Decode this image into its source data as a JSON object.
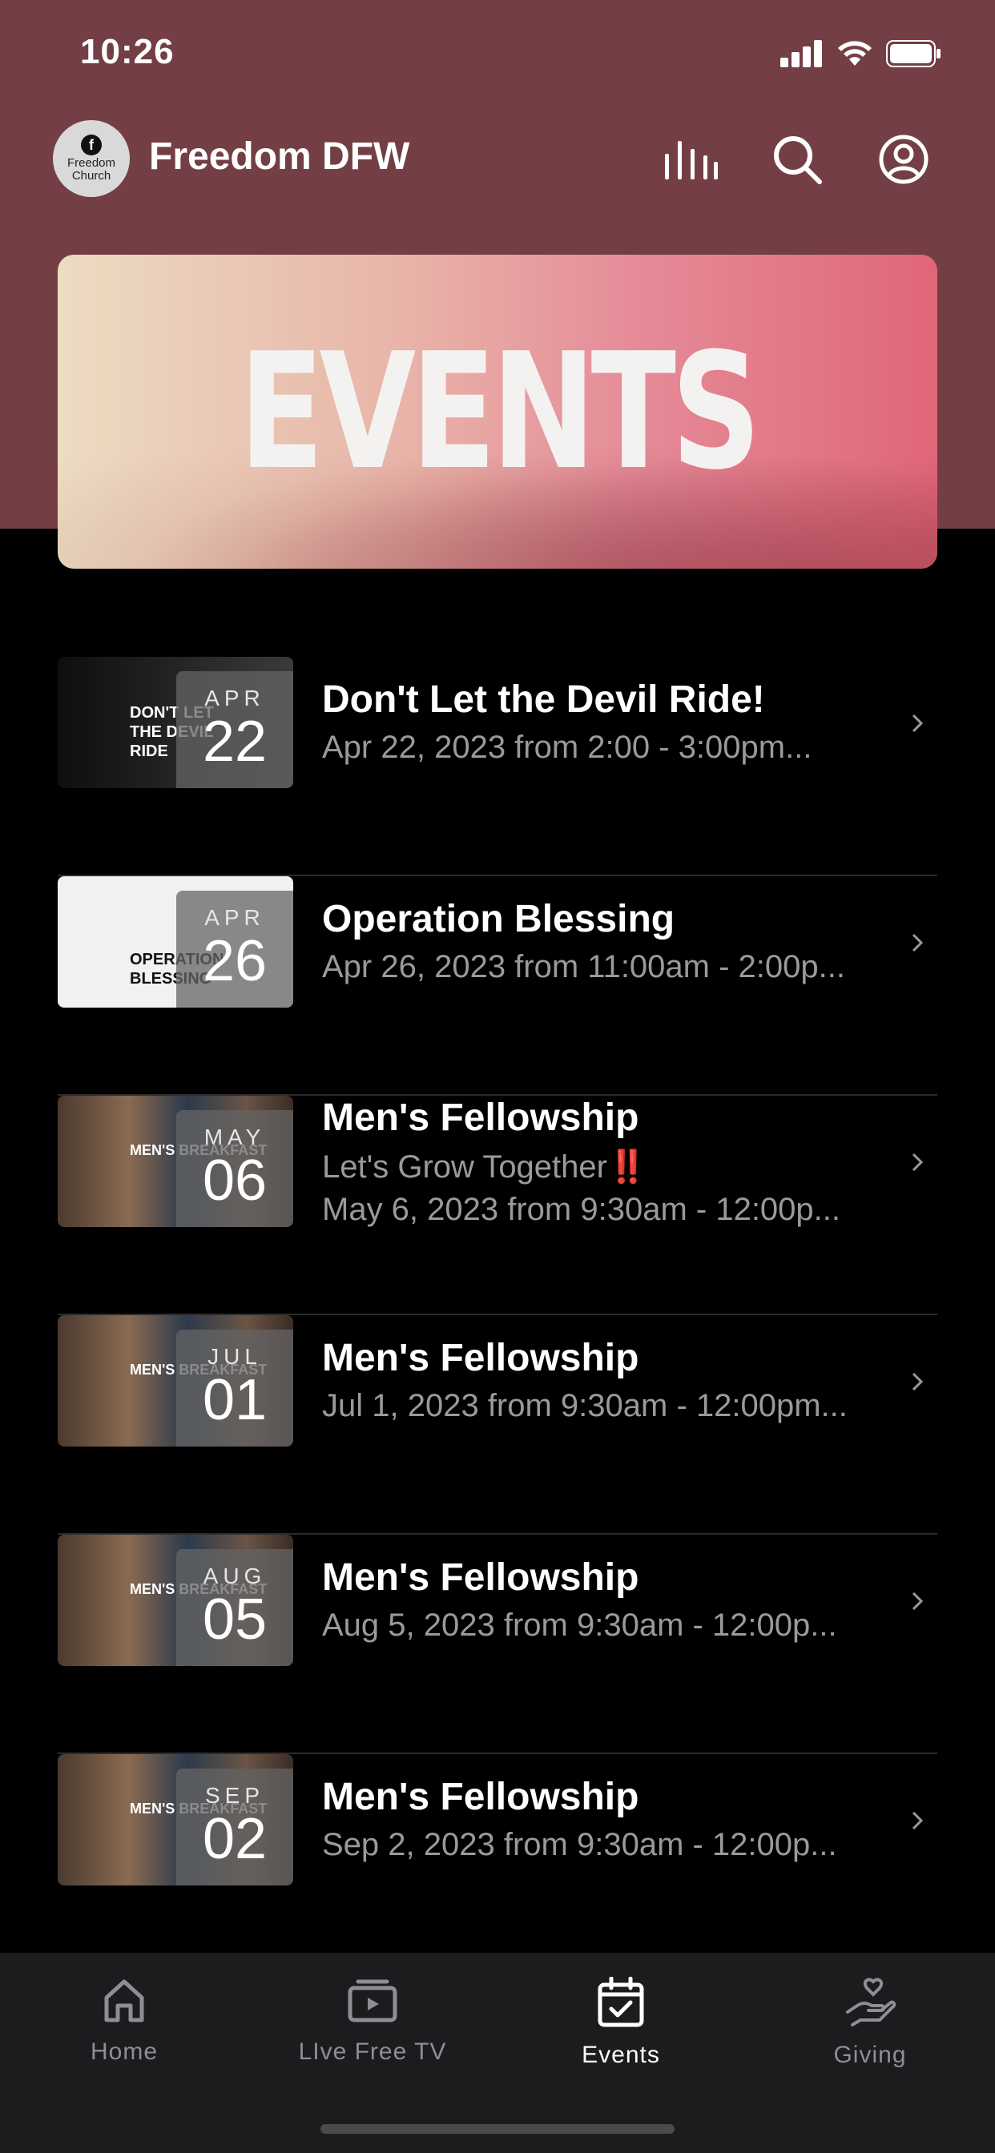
{
  "status_bar": {
    "time": "10:26"
  },
  "header": {
    "logo_text": "Freedom Church",
    "title": "Freedom DFW"
  },
  "banner": {
    "text": "EVENTS"
  },
  "events": [
    {
      "title": "Don't Let the Devil Ride!",
      "subtitle": "",
      "datetime": "Apr 22, 2023 from 2:00 - 3:00pm...",
      "month": "APR",
      "day": "22",
      "thumb_text": "DON'T LET THE DEVIL RIDE"
    },
    {
      "title": "Operation Blessing",
      "subtitle": "",
      "datetime": "Apr 26, 2023 from 11:00am - 2:00p...",
      "month": "APR",
      "day": "26",
      "thumb_text": "OPERATION BLESSING"
    },
    {
      "title": "Men's Fellowship",
      "subtitle": "Let's Grow Together‼️",
      "datetime": "May 6, 2023 from 9:30am - 12:00p...",
      "month": "MAY",
      "day": "06",
      "thumb_text": "MEN'S BREAKFAST"
    },
    {
      "title": "Men's Fellowship",
      "subtitle": "",
      "datetime": "Jul 1, 2023 from 9:30am - 12:00pm...",
      "month": "JUL",
      "day": "01",
      "thumb_text": "MEN'S BREAKFAST"
    },
    {
      "title": "Men's Fellowship",
      "subtitle": "",
      "datetime": "Aug 5, 2023 from 9:30am - 12:00p...",
      "month": "AUG",
      "day": "05",
      "thumb_text": "MEN'S BREAKFAST"
    },
    {
      "title": "Men's Fellowship",
      "subtitle": "",
      "datetime": "Sep 2, 2023 from 9:30am - 12:00p...",
      "month": "SEP",
      "day": "02",
      "thumb_text": "MEN'S BREAKFAST"
    }
  ],
  "tabbar": {
    "home": "Home",
    "tv": "LIve Free TV",
    "events": "Events",
    "giving": "Giving"
  },
  "colors": {
    "header_bg": "#733f45",
    "active_tab": "#ffffff",
    "inactive_tab": "#8e8e93"
  }
}
